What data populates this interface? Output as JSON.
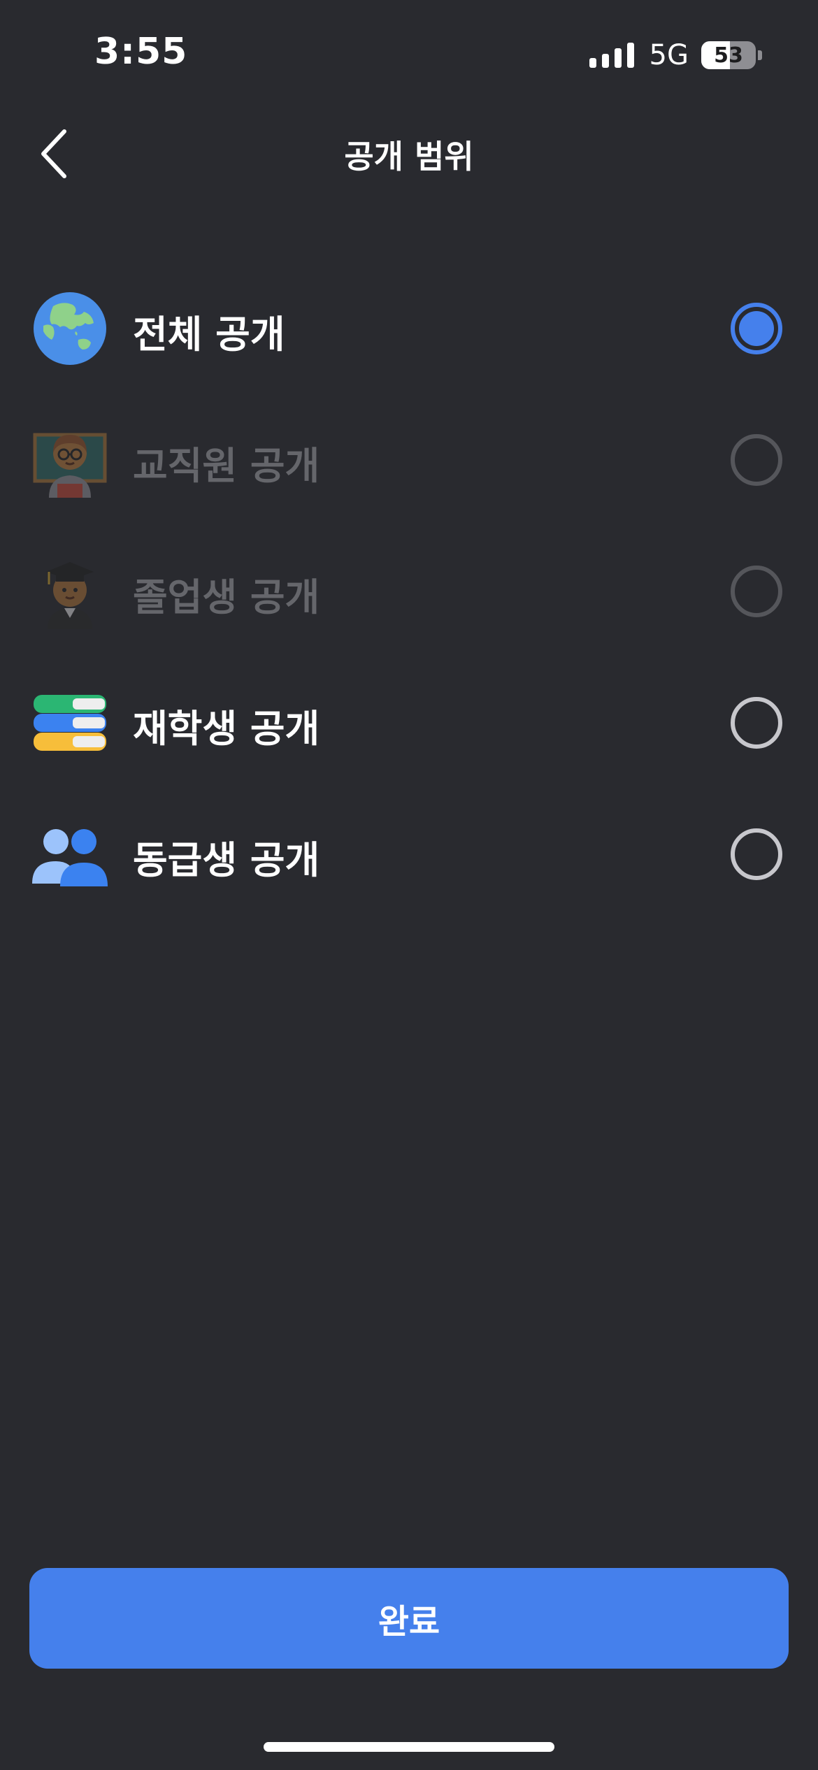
{
  "status_bar": {
    "time": "3:55",
    "network": "5G",
    "battery_percent": "53",
    "battery_level": 0.53
  },
  "nav": {
    "back_icon": "chevron-left-icon",
    "title": "공개 범위"
  },
  "options": [
    {
      "icon": "globe-icon",
      "label": "전체 공개",
      "selected": true,
      "enabled": true
    },
    {
      "icon": "teacher-icon",
      "label": "교직원 공개",
      "selected": false,
      "enabled": false
    },
    {
      "icon": "graduate-icon",
      "label": "졸업생 공개",
      "selected": false,
      "enabled": false
    },
    {
      "icon": "books-icon",
      "label": "재학생 공개",
      "selected": false,
      "enabled": true
    },
    {
      "icon": "people-icon",
      "label": "동급생 공개",
      "selected": false,
      "enabled": true
    }
  ],
  "done_button": {
    "label": "완료"
  },
  "colors": {
    "background": "#292a2f",
    "accent": "#4580ec",
    "disabled_text": "#65666b"
  }
}
